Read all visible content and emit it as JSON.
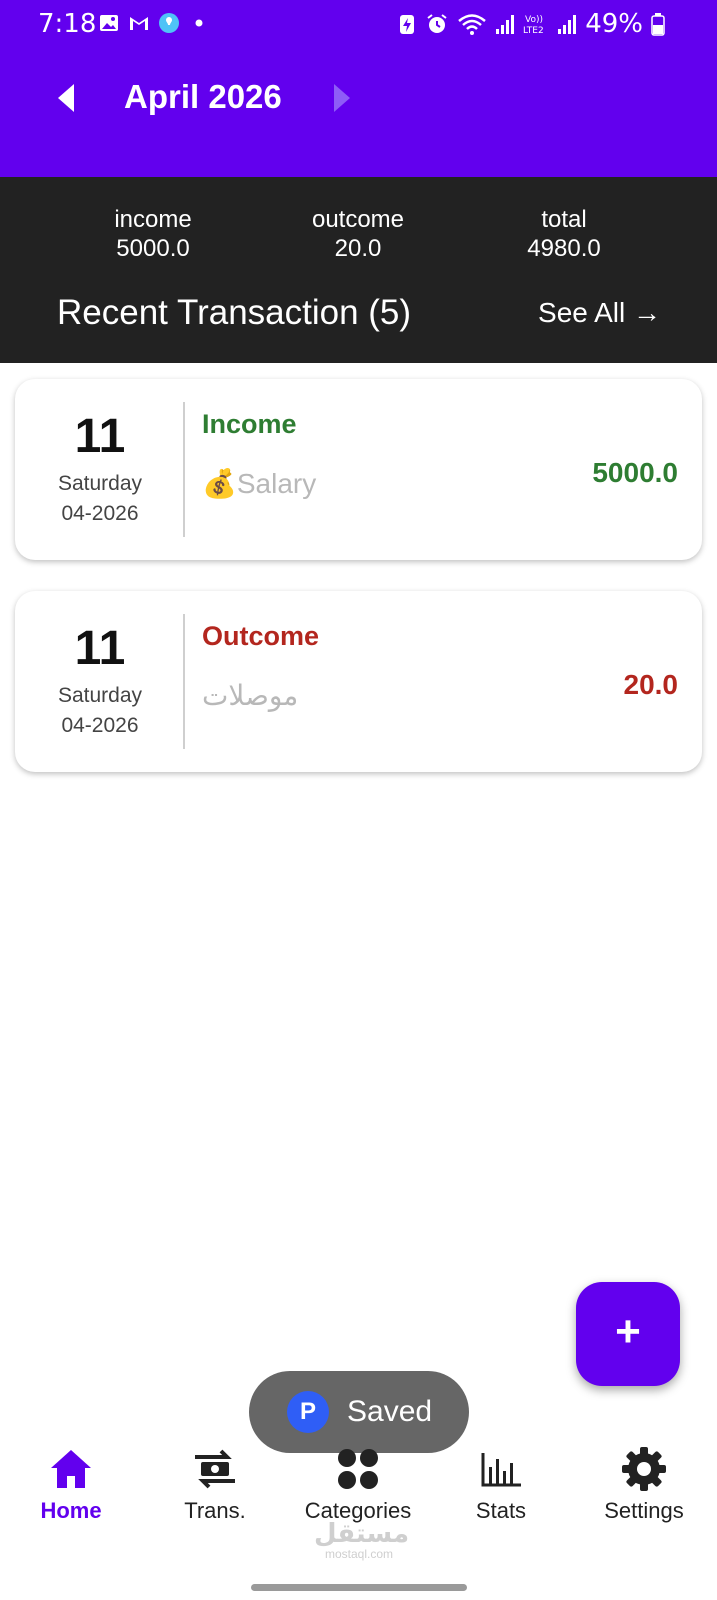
{
  "status_bar": {
    "time": "7:18",
    "battery": "49%",
    "left_icons": [
      "gallery-icon",
      "gmail-icon",
      "bulb-app-icon",
      "dot-icon"
    ],
    "right_icons": [
      "battery-saver-icon",
      "alarm-icon",
      "wifi-icon",
      "signal-icon",
      "volte-icon",
      "signal-icon",
      "battery-icon"
    ]
  },
  "header": {
    "month_title": "April 2026",
    "prev_icon": "arrow-left-icon",
    "next_icon": "arrow-right-icon"
  },
  "summary": {
    "income_label": "income",
    "income_value": "5000.0",
    "outcome_label": "outcome",
    "outcome_value": "20.0",
    "total_label": "total",
    "total_value": "4980.0",
    "recent_title": "Recent Transaction (5)",
    "see_all": "See All →"
  },
  "transactions": [
    {
      "day": "11",
      "weekday": "Saturday",
      "month_year": "04-2026",
      "type": "Income",
      "category": "💰Salary",
      "amount": "5000.0",
      "color": "#2e7d32"
    },
    {
      "day": "11",
      "weekday": "Saturday",
      "month_year": "04-2026",
      "type": "Outcome",
      "category": "موصلات",
      "amount": "20.0",
      "color": "#b3261e"
    }
  ],
  "fab": {
    "label": "+"
  },
  "toast": {
    "icon_letter": "P",
    "text": "Saved"
  },
  "nav": {
    "items": [
      {
        "label": "Home",
        "icon": "home-icon",
        "active": true
      },
      {
        "label": "Trans.",
        "icon": "transfer-icon",
        "active": false
      },
      {
        "label": "Categories",
        "icon": "categories-icon",
        "active": false
      },
      {
        "label": "Stats",
        "icon": "stats-icon",
        "active": false
      },
      {
        "label": "Settings",
        "icon": "gear-icon",
        "active": false
      }
    ]
  },
  "watermark": {
    "arabic": "مستقل",
    "latin": "mostaql.com"
  },
  "colors": {
    "primary": "#6200ee",
    "summary_bg": "#222222",
    "income": "#2e7d32",
    "outcome": "#b3261e"
  }
}
